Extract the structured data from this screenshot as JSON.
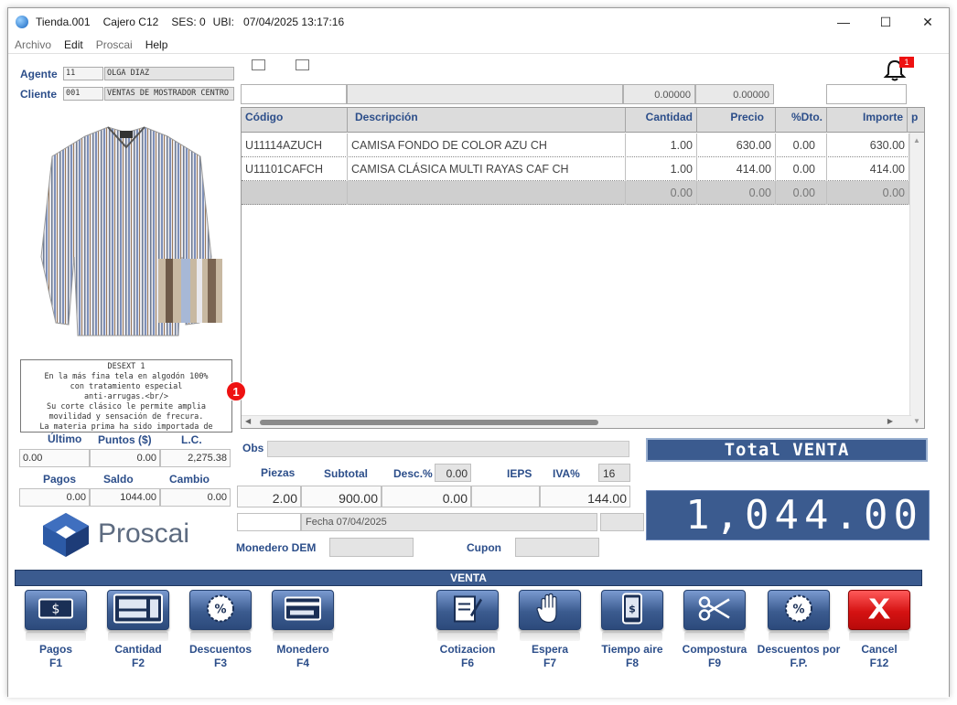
{
  "titlebar": {
    "app": "Tienda.001",
    "cajero": "Cajero C12",
    "ses": "SES: 0",
    "ubi": "UBI:",
    "datetime": "07/04/2025 13:17:16"
  },
  "menu": [
    "Archivo",
    "Edit",
    "Proscai",
    "Help"
  ],
  "agente": {
    "label": "Agente",
    "code": "11",
    "name": "OLGA DIAZ"
  },
  "cliente": {
    "label": "Cliente",
    "code": "001",
    "name": "VENTAS DE MOSTRADOR CENTRO"
  },
  "notif_count": "1",
  "top_values": {
    "v1": "0.00000",
    "v2": "0.00000"
  },
  "grid": {
    "headers": [
      "Código",
      "Descripción",
      "Cantidad",
      "Precio",
      "%Dto.",
      "Importe",
      "p"
    ],
    "rows": [
      [
        "U11114AZUCH",
        "CAMISA FONDO DE COLOR AZU CH",
        "1.00",
        "630.00",
        "0.00",
        "630.00"
      ],
      [
        "U11101CAFCH",
        "CAMISA CLÁSICA MULTI RAYAS CAF CH",
        "1.00",
        "414.00",
        "0.00",
        "414.00"
      ],
      [
        "",
        "",
        "0.00",
        "0.00",
        "0.00",
        "0.00"
      ]
    ]
  },
  "description": {
    "lines": [
      "DESEXT 1",
      "En la más fina tela en algodón 100%",
      "con tratamiento especial",
      "anti-arrugas.<br/>",
      "Su corte clásico le permite amplia",
      "movilidad y sensación de frecura.",
      "La materia prima ha sido importada de"
    ],
    "badge": "1"
  },
  "account": {
    "ultimo_label": "Último",
    "puntos_label": "Puntos ($)",
    "lc_label": "L.C.",
    "ultimo": "0.00",
    "puntos": "0.00",
    "lc": "2,275.38",
    "pagos_label": "Pagos",
    "saldo_label": "Saldo",
    "cambio_label": "Cambio",
    "pagos": "0.00",
    "saldo": "1044.00",
    "cambio": "0.00"
  },
  "logo_text": "Proscai",
  "summary": {
    "obs_label": "Obs",
    "piezas_label": "Piezas",
    "subtotal_label": "Subtotal",
    "desc_label": "Desc.%",
    "desc_pct": "0.00",
    "ieps_label": "IEPS",
    "iva_label": "IVA%",
    "iva_pct": "16",
    "piezas": "2.00",
    "subtotal": "900.00",
    "desc": "0.00",
    "ieps": "",
    "iva": "144.00",
    "fecha": "Fecha 07/04/2025",
    "monedero_label": "Monedero DEM",
    "cupon_label": "Cupon"
  },
  "total": {
    "label": "Total VENTA",
    "value": "1,044.00"
  },
  "venta_bar": "VENTA",
  "fkeys": [
    {
      "label": "Pagos",
      "key": "F1",
      "icon": "cash-icon"
    },
    {
      "label": "Cantidad",
      "key": "F2",
      "icon": "calculator-icon"
    },
    {
      "label": "Descuentos",
      "key": "F3",
      "icon": "percent-badge-icon"
    },
    {
      "label": "Monedero",
      "key": "F4",
      "icon": "card-icon"
    },
    {
      "label": "Cotizacion",
      "key": "F6",
      "icon": "quote-edit-icon"
    },
    {
      "label": "Espera",
      "key": "F7",
      "icon": "hand-icon"
    },
    {
      "label": "Tiempo aire",
      "key": "F8",
      "icon": "phone-credit-icon"
    },
    {
      "label": "Compostura",
      "key": "F9",
      "icon": "scissors-icon"
    },
    {
      "label": "Descuentos por F.P.",
      "key": "F.P.",
      "icon": "percent-badge-icon"
    },
    {
      "label": "Cancel",
      "key": "F12",
      "icon": "cancel-x-icon"
    }
  ],
  "colors": {
    "accent": "#3b5b8f",
    "label_blue": "#2c4e8a",
    "cancel_red": "#d51212"
  }
}
